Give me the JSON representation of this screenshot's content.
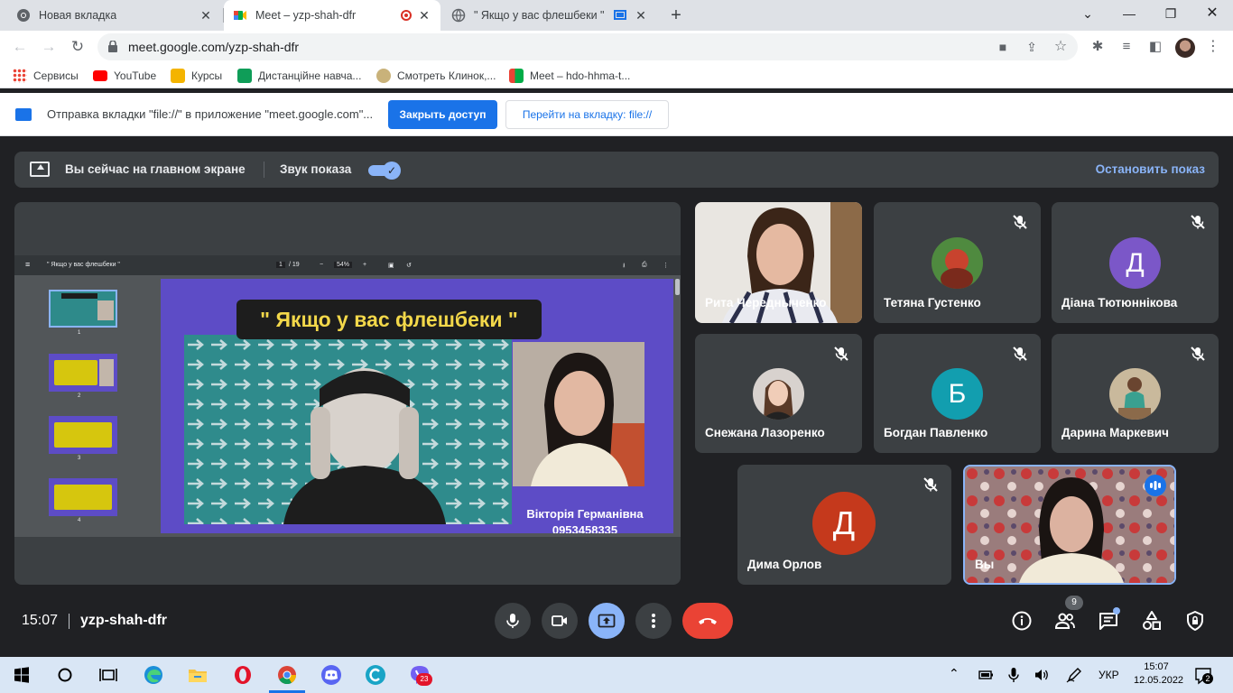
{
  "browser": {
    "tabs": [
      {
        "title": "Новая вкладка",
        "active": false
      },
      {
        "title": "Meet – yzp-shah-dfr",
        "active": true
      },
      {
        "title": "\" Якщо у вас флешбеки \"",
        "active": false
      }
    ],
    "url": "meet.google.com/yzp-shah-dfr",
    "bookmarks": [
      "Сервисы",
      "YouTube",
      "Курсы",
      "Дистанційне навча...",
      "Смотреть Клинок,...",
      "Meet – hdo-hhma-t..."
    ],
    "infobar": {
      "text": "Отправка вкладки \"file://\" в приложение \"meet.google.com\"...",
      "primary_button": "Закрыть доступ",
      "secondary_button": "Перейти на вкладку: file://"
    }
  },
  "presentation_bar": {
    "main_text": "Вы сейчас на главном экране",
    "sound_label": "Звук показа",
    "sound_on": true,
    "stop_label": "Остановить показ"
  },
  "shared_screen": {
    "doc_title": "\" Якщо у вас флешбеки \"",
    "page_current": "1",
    "page_total": "/ 19",
    "zoom": "54%",
    "thumb_numbers": [
      "1",
      "2",
      "3",
      "4"
    ],
    "slide": {
      "title": "\" Якщо у вас флешбеки \"",
      "name": "Вікторія Германівна",
      "phone": "0953458335"
    }
  },
  "participants": [
    {
      "name": "Рита Чередныченко",
      "type": "video",
      "muted": false
    },
    {
      "name": "Тетяна Густенко",
      "type": "photo",
      "muted": true
    },
    {
      "name": "Діана Тютюннікова",
      "type": "letter",
      "letter": "Д",
      "color": "#7b57c8",
      "muted": true
    },
    {
      "name": "Снежана Лазоренко",
      "type": "photo",
      "muted": true
    },
    {
      "name": "Богдан Павленко",
      "type": "letter",
      "letter": "Б",
      "color": "#129eaf",
      "muted": true
    },
    {
      "name": "Дарина Маркевич",
      "type": "photo",
      "muted": true
    },
    {
      "name": "Дима Орлов",
      "type": "letter",
      "letter": "Д",
      "color": "#c5391c",
      "muted": true
    },
    {
      "name": "Вы",
      "type": "video",
      "muted": false,
      "speaking": true
    }
  ],
  "meeting_bar": {
    "time": "15:07",
    "code": "yzp-shah-dfr",
    "people_count": "9"
  },
  "taskbar": {
    "language": "УКР",
    "time": "15:07",
    "date": "12.05.2022",
    "viber_badge": "23",
    "notification_count": "2"
  },
  "colors": {
    "meet_bg": "#202124",
    "tile_bg": "#3c4043",
    "accent": "#8ab4f8",
    "hangup": "#ea4335",
    "chrome_blue": "#1a73e8"
  }
}
